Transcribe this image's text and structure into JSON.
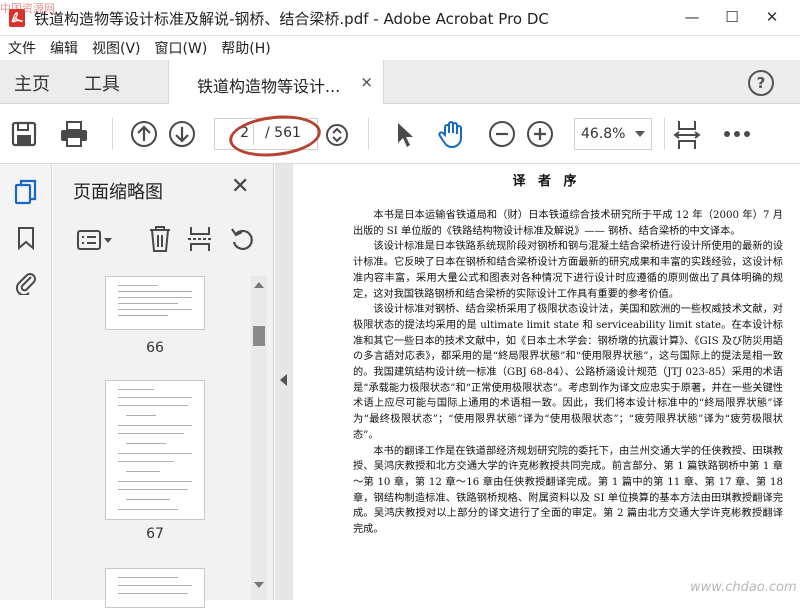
{
  "window": {
    "title": "铁道构造物等设计标准及解说-钢桥、结合梁桥.pdf - Adobe Acrobat Pro DC",
    "minimize_label": "—",
    "maximize_label": "☐",
    "close_label": "✕"
  },
  "watermark": {
    "top_left": "中国资源网",
    "bottom_right": "www.chdao.com"
  },
  "menu": {
    "items": [
      "文件",
      "编辑",
      "视图(V)",
      "窗口(W)",
      "帮助(H)"
    ]
  },
  "tabs": {
    "home": "主页",
    "tools": "工具",
    "doc_tab": "铁道构造物等设计...",
    "doc_close": "×",
    "help": "?"
  },
  "toolbar": {
    "page_current": "2",
    "page_total": "/ 561",
    "zoom": "46.8%",
    "accent_color": "#4a4a4a",
    "highlight_color": "#b5432f"
  },
  "thumbnails": {
    "panel_title": "页面缩略图",
    "panel_close": "✕",
    "pages": [
      "66",
      "67"
    ]
  },
  "document": {
    "heading": "译 者 序",
    "paragraphs": [
      "本书是日本运输省铁道局和（财）日本铁道综合技术研究所于平成 12 年（2000 年）7 月出版的 SI 单位版的《铁路结构物设计标准及解说》—— 钢桥、结合梁桥的中文译本。",
      "该设计标准是日本铁路系统现阶段对钢桥和钢与混凝土结合梁桥进行设计所使用的最新的设计标准。它反映了日本在钢桥和结合梁桥设计方面最新的研究成果和丰富的实践经验，这设计标准内容丰富，采用大量公式和图表对各种情况下进行设计时应遵循的原则做出了具体明确的规定，这对我国铁路钢桥和结合梁桥的实际设计工作具有重要的参考价值。",
      "该设计标准对钢桥、结合梁桥采用了极限状态设计法，美国和欧洲的一些权威技术文献，对极限状态的提法均采用的是 ultimate limit state 和 serviceability limit state。在本设计标准和其它一些日本的技术文献中，如《日本土木学会：钢桥墩的抗震计算》、《GIS 及び防災用語の多言語対応表》，都采用的是“終局限界状態”和“使用限界状態”，这与国际上的提法是相一致的。我国建筑结构设计统一标准（GBJ 68-84）、公路桥涵设计规范（JTJ 023-85）采用的术语是“承载能力极限状态”和“正常使用极限状态”。考虑到作为译文应忠实于原著，并在一些关键性术语上应尽可能与国际上通用的术语相一致。因此，我们将本设计标准中的“終局限界状態”译为“最终极限状态”；“使用限界状態”译为“使用极限状态”；“疲劳限界状態”译为“疲劳极限状态”。",
      "本书的翻译工作是在铁道部经济规划研究院的委托下，由兰州交通大学的任侠教授、田琪教授、吴鸿庆教授和北方交通大学的许克彬教授共同完成。前言部分、第 1 篇铁路钢桥中第 1 章～第 10 章，第 12 章～16 章由任侠教授翻译完成。第 1 篇中的第 11 章、第 17 章、第 18 章，钢结构制造标准、铁路钢桥规格、附属资料以及 SI 单位换算的基本方法由田琪教授翻译完成。吴鸿庆教授对以上部分的译文进行了全面的审定。第 2 篇由北方交通大学许克彬教授翻译完成。"
    ]
  }
}
